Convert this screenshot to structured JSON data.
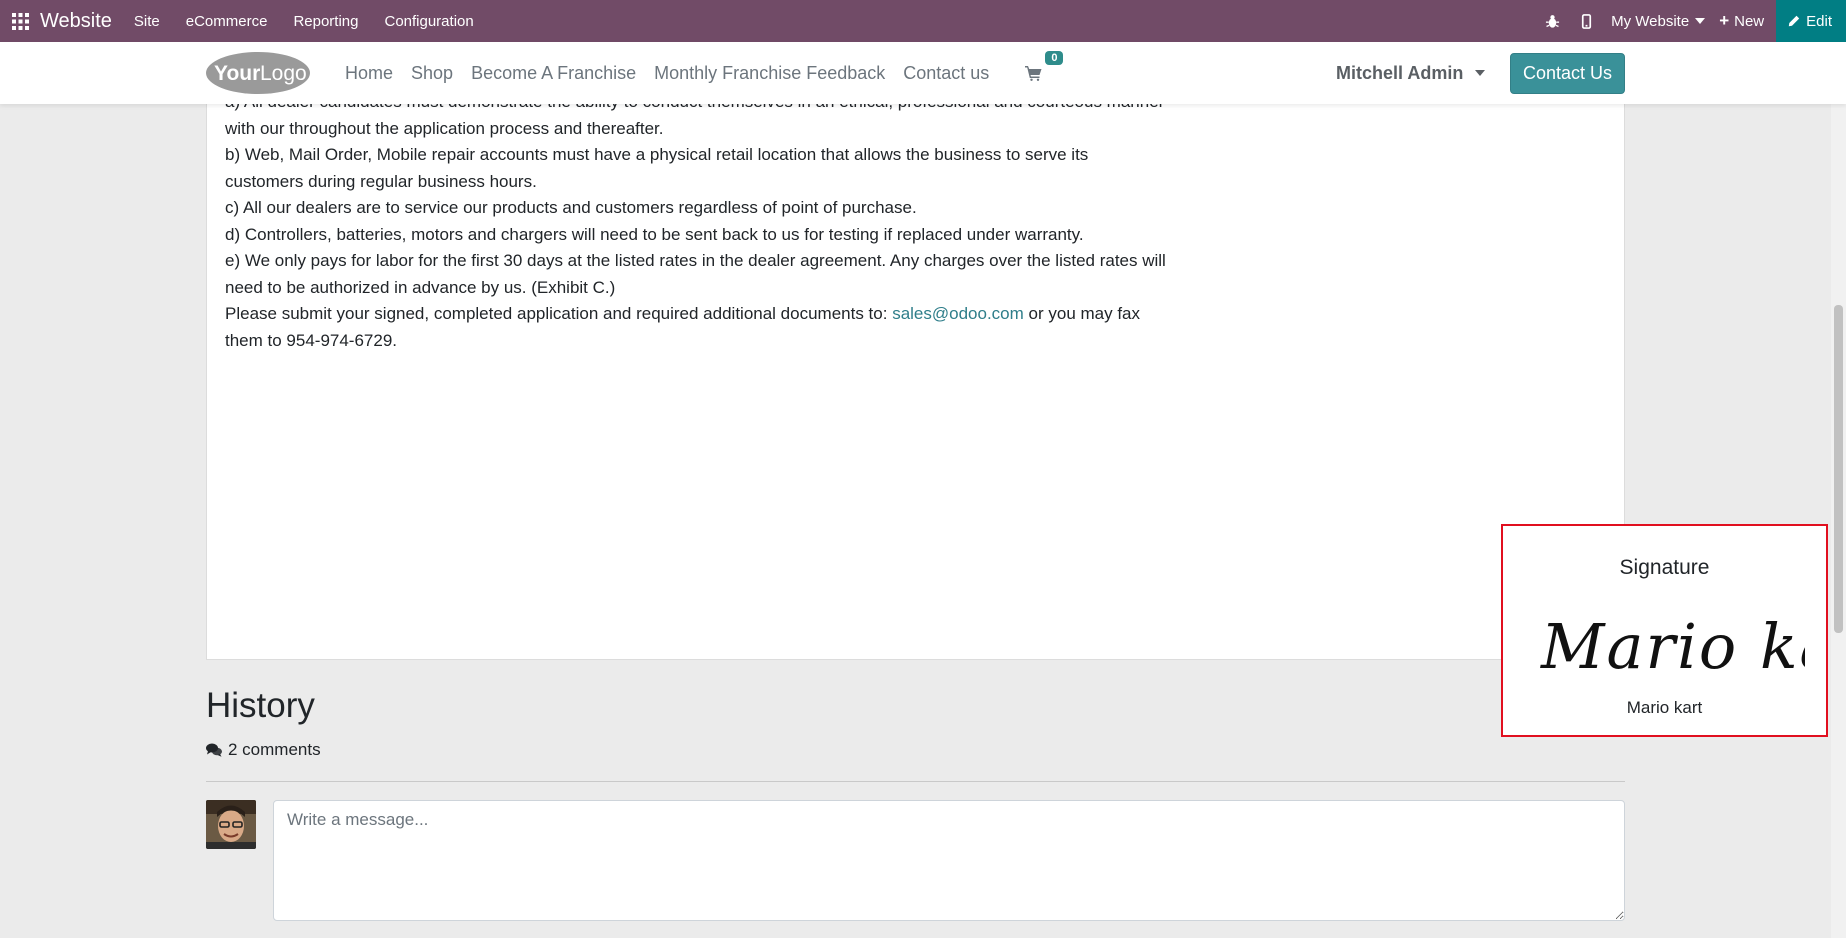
{
  "adminbar": {
    "brand": "Website",
    "menu": [
      "Site",
      "eCommerce",
      "Reporting",
      "Configuration"
    ],
    "website_selector": "My Website",
    "new_label": "New",
    "edit_label": "Edit",
    "bg_color": "#714b67",
    "edit_color": "#017e84"
  },
  "navbar": {
    "logo_text": "YourLogo",
    "links": [
      "Home",
      "Shop",
      "Become A Franchise",
      "Monthly Franchise Feedback",
      "Contact us"
    ],
    "cart_count": "0",
    "user": "Mitchell Admin",
    "contact_button": "Contact Us"
  },
  "document": {
    "lines": [
      "a) All dealer candidates must demonstrate the ability to conduct themselves in an ethical, professional and courteous manner",
      "with our throughout the application process and thereafter.",
      "b) Web, Mail Order, Mobile repair accounts must have a physical retail location that allows the business to serve its",
      "customers during regular business hours.",
      "c) All our dealers are to service our products and customers regardless of point of purchase.",
      "d) Controllers, batteries, motors and chargers will need to be sent back to us for testing if replaced under warranty.",
      "e) We only pays for labor for the first 30 days at the listed rates in the dealer agreement. Any charges over the listed rates will",
      "need to be authorized in advance by us. (Exhibit C.)"
    ],
    "submit_prefix": "Please submit your signed, completed application and required additional documents to: ",
    "submit_email": "sales@odoo.com",
    "submit_suffix": " or you may fax",
    "submit_line2": "them to 954-974-6729."
  },
  "signature": {
    "title": "Signature",
    "signed_text": "Mario kart",
    "name": "Mario kart",
    "highlight_color": "#e10f1f"
  },
  "history": {
    "title": "History",
    "comments": "2 comments",
    "message_placeholder": "Write a message..."
  }
}
